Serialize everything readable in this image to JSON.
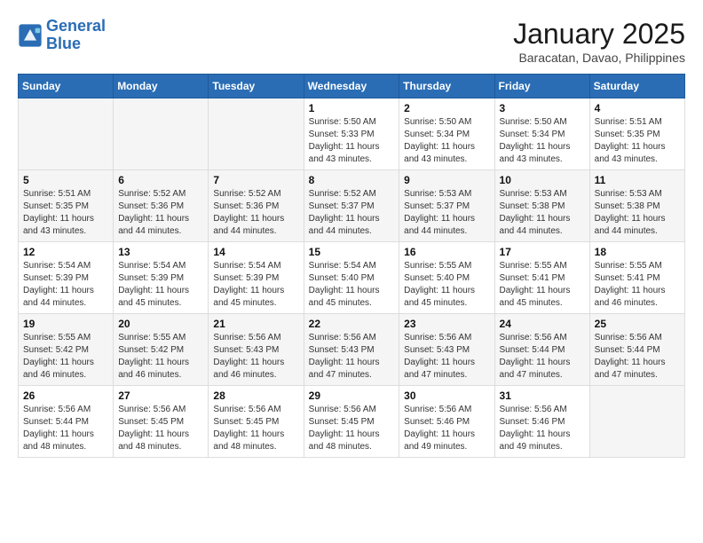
{
  "logo": {
    "line1": "General",
    "line2": "Blue"
  },
  "title": "January 2025",
  "subtitle": "Baracatan, Davao, Philippines",
  "days_of_week": [
    "Sunday",
    "Monday",
    "Tuesday",
    "Wednesday",
    "Thursday",
    "Friday",
    "Saturday"
  ],
  "weeks": [
    [
      {
        "day": "",
        "sunrise": "",
        "sunset": "",
        "daylight": ""
      },
      {
        "day": "",
        "sunrise": "",
        "sunset": "",
        "daylight": ""
      },
      {
        "day": "",
        "sunrise": "",
        "sunset": "",
        "daylight": ""
      },
      {
        "day": "1",
        "sunrise": "Sunrise: 5:50 AM",
        "sunset": "Sunset: 5:33 PM",
        "daylight": "Daylight: 11 hours and 43 minutes."
      },
      {
        "day": "2",
        "sunrise": "Sunrise: 5:50 AM",
        "sunset": "Sunset: 5:34 PM",
        "daylight": "Daylight: 11 hours and 43 minutes."
      },
      {
        "day": "3",
        "sunrise": "Sunrise: 5:50 AM",
        "sunset": "Sunset: 5:34 PM",
        "daylight": "Daylight: 11 hours and 43 minutes."
      },
      {
        "day": "4",
        "sunrise": "Sunrise: 5:51 AM",
        "sunset": "Sunset: 5:35 PM",
        "daylight": "Daylight: 11 hours and 43 minutes."
      }
    ],
    [
      {
        "day": "5",
        "sunrise": "Sunrise: 5:51 AM",
        "sunset": "Sunset: 5:35 PM",
        "daylight": "Daylight: 11 hours and 43 minutes."
      },
      {
        "day": "6",
        "sunrise": "Sunrise: 5:52 AM",
        "sunset": "Sunset: 5:36 PM",
        "daylight": "Daylight: 11 hours and 44 minutes."
      },
      {
        "day": "7",
        "sunrise": "Sunrise: 5:52 AM",
        "sunset": "Sunset: 5:36 PM",
        "daylight": "Daylight: 11 hours and 44 minutes."
      },
      {
        "day": "8",
        "sunrise": "Sunrise: 5:52 AM",
        "sunset": "Sunset: 5:37 PM",
        "daylight": "Daylight: 11 hours and 44 minutes."
      },
      {
        "day": "9",
        "sunrise": "Sunrise: 5:53 AM",
        "sunset": "Sunset: 5:37 PM",
        "daylight": "Daylight: 11 hours and 44 minutes."
      },
      {
        "day": "10",
        "sunrise": "Sunrise: 5:53 AM",
        "sunset": "Sunset: 5:38 PM",
        "daylight": "Daylight: 11 hours and 44 minutes."
      },
      {
        "day": "11",
        "sunrise": "Sunrise: 5:53 AM",
        "sunset": "Sunset: 5:38 PM",
        "daylight": "Daylight: 11 hours and 44 minutes."
      }
    ],
    [
      {
        "day": "12",
        "sunrise": "Sunrise: 5:54 AM",
        "sunset": "Sunset: 5:39 PM",
        "daylight": "Daylight: 11 hours and 44 minutes."
      },
      {
        "day": "13",
        "sunrise": "Sunrise: 5:54 AM",
        "sunset": "Sunset: 5:39 PM",
        "daylight": "Daylight: 11 hours and 45 minutes."
      },
      {
        "day": "14",
        "sunrise": "Sunrise: 5:54 AM",
        "sunset": "Sunset: 5:39 PM",
        "daylight": "Daylight: 11 hours and 45 minutes."
      },
      {
        "day": "15",
        "sunrise": "Sunrise: 5:54 AM",
        "sunset": "Sunset: 5:40 PM",
        "daylight": "Daylight: 11 hours and 45 minutes."
      },
      {
        "day": "16",
        "sunrise": "Sunrise: 5:55 AM",
        "sunset": "Sunset: 5:40 PM",
        "daylight": "Daylight: 11 hours and 45 minutes."
      },
      {
        "day": "17",
        "sunrise": "Sunrise: 5:55 AM",
        "sunset": "Sunset: 5:41 PM",
        "daylight": "Daylight: 11 hours and 45 minutes."
      },
      {
        "day": "18",
        "sunrise": "Sunrise: 5:55 AM",
        "sunset": "Sunset: 5:41 PM",
        "daylight": "Daylight: 11 hours and 46 minutes."
      }
    ],
    [
      {
        "day": "19",
        "sunrise": "Sunrise: 5:55 AM",
        "sunset": "Sunset: 5:42 PM",
        "daylight": "Daylight: 11 hours and 46 minutes."
      },
      {
        "day": "20",
        "sunrise": "Sunrise: 5:55 AM",
        "sunset": "Sunset: 5:42 PM",
        "daylight": "Daylight: 11 hours and 46 minutes."
      },
      {
        "day": "21",
        "sunrise": "Sunrise: 5:56 AM",
        "sunset": "Sunset: 5:43 PM",
        "daylight": "Daylight: 11 hours and 46 minutes."
      },
      {
        "day": "22",
        "sunrise": "Sunrise: 5:56 AM",
        "sunset": "Sunset: 5:43 PM",
        "daylight": "Daylight: 11 hours and 47 minutes."
      },
      {
        "day": "23",
        "sunrise": "Sunrise: 5:56 AM",
        "sunset": "Sunset: 5:43 PM",
        "daylight": "Daylight: 11 hours and 47 minutes."
      },
      {
        "day": "24",
        "sunrise": "Sunrise: 5:56 AM",
        "sunset": "Sunset: 5:44 PM",
        "daylight": "Daylight: 11 hours and 47 minutes."
      },
      {
        "day": "25",
        "sunrise": "Sunrise: 5:56 AM",
        "sunset": "Sunset: 5:44 PM",
        "daylight": "Daylight: 11 hours and 47 minutes."
      }
    ],
    [
      {
        "day": "26",
        "sunrise": "Sunrise: 5:56 AM",
        "sunset": "Sunset: 5:44 PM",
        "daylight": "Daylight: 11 hours and 48 minutes."
      },
      {
        "day": "27",
        "sunrise": "Sunrise: 5:56 AM",
        "sunset": "Sunset: 5:45 PM",
        "daylight": "Daylight: 11 hours and 48 minutes."
      },
      {
        "day": "28",
        "sunrise": "Sunrise: 5:56 AM",
        "sunset": "Sunset: 5:45 PM",
        "daylight": "Daylight: 11 hours and 48 minutes."
      },
      {
        "day": "29",
        "sunrise": "Sunrise: 5:56 AM",
        "sunset": "Sunset: 5:45 PM",
        "daylight": "Daylight: 11 hours and 48 minutes."
      },
      {
        "day": "30",
        "sunrise": "Sunrise: 5:56 AM",
        "sunset": "Sunset: 5:46 PM",
        "daylight": "Daylight: 11 hours and 49 minutes."
      },
      {
        "day": "31",
        "sunrise": "Sunrise: 5:56 AM",
        "sunset": "Sunset: 5:46 PM",
        "daylight": "Daylight: 11 hours and 49 minutes."
      },
      {
        "day": "",
        "sunrise": "",
        "sunset": "",
        "daylight": ""
      }
    ]
  ]
}
